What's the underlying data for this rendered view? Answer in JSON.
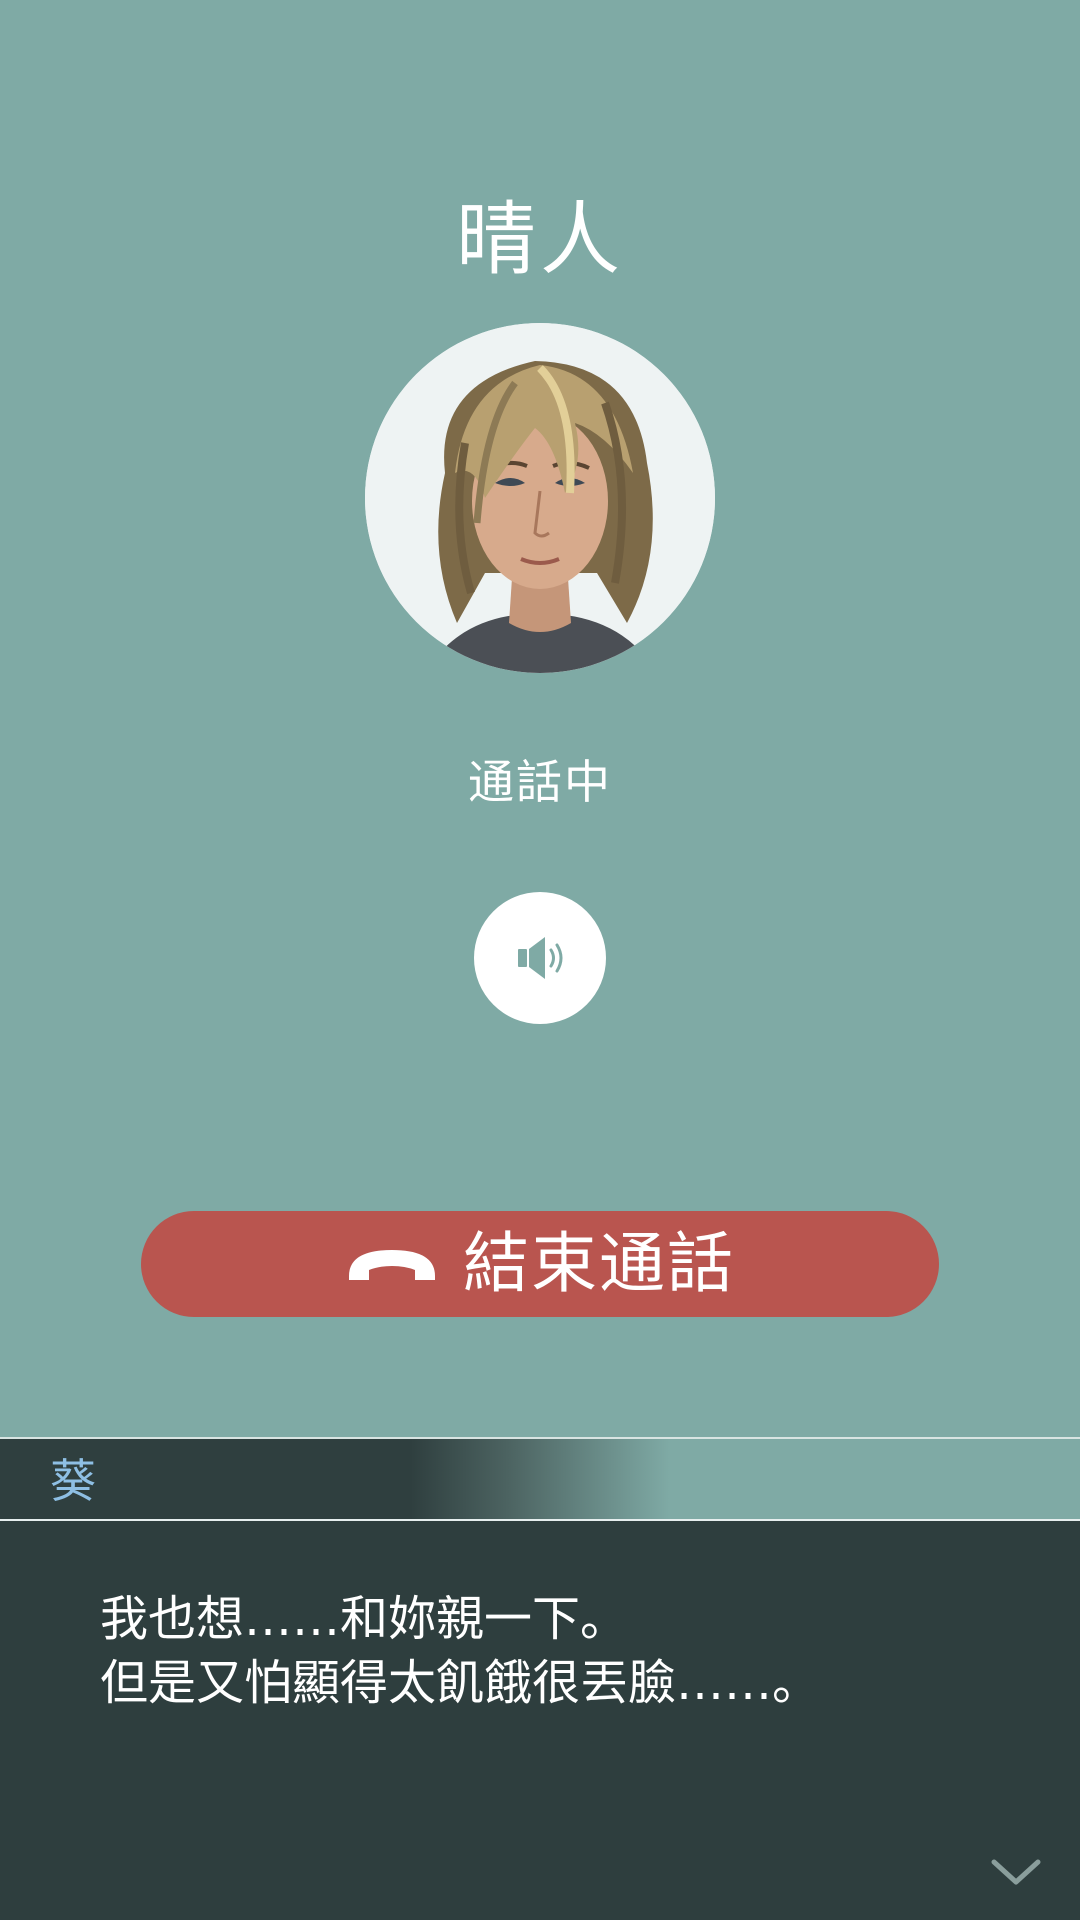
{
  "call": {
    "caller_name": "晴人",
    "status": "通話中",
    "end_call_label": "結束通話"
  },
  "icons": {
    "avatar": "caller-portrait",
    "speaker": "speaker-icon",
    "end_call": "hang-up-phone-icon",
    "advance": "chevron-down-icon"
  },
  "dialogue": {
    "speaker": "葵",
    "lines": [
      "我也想……和妳親一下。",
      "但是又怕顯得太飢餓很丟臉……。"
    ]
  },
  "colors": {
    "background": "#7faaa5",
    "end_call_button": "#b9554f",
    "dialogue_box": "#2e3e3e",
    "speaker_name": "#8ebfe4"
  }
}
